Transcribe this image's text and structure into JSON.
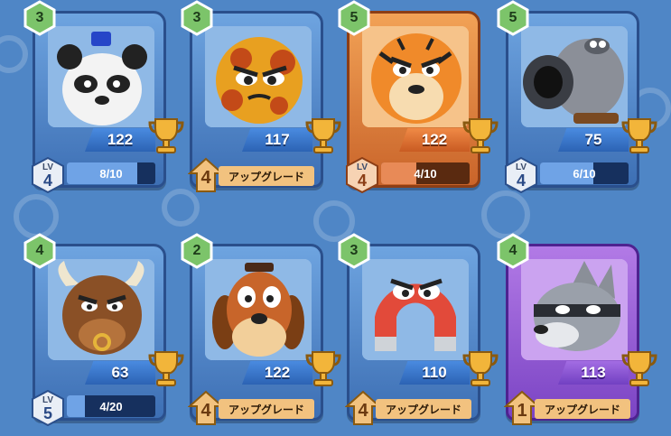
{
  "colors": {
    "background": "#4f86c6",
    "blue_frame": "#3d6fb4",
    "orange_frame": "#c9642a",
    "purple_frame": "#7b44c4",
    "gem_green": "#7cc46a",
    "gold": "#f2b53a"
  },
  "cards": [
    {
      "character": "panda",
      "star": "3",
      "trophies": "122",
      "frame": "blue",
      "lv_label": "LV",
      "level": "4",
      "progress": "8/10",
      "progress_fraction": 0.8
    },
    {
      "character": "fire-ball",
      "star": "3",
      "trophies": "117",
      "frame": "blue",
      "upgrade_count": "4",
      "upgrade_label": "アップグレード"
    },
    {
      "character": "tiger",
      "star": "5",
      "trophies": "122",
      "frame": "orange",
      "lv_label": "LV",
      "level": "4",
      "progress": "4/10",
      "progress_fraction": 0.4
    },
    {
      "character": "cannon-hippo",
      "star": "5",
      "trophies": "75",
      "frame": "blue",
      "lv_label": "LV",
      "level": "4",
      "progress": "6/10",
      "progress_fraction": 0.6
    },
    {
      "character": "bull",
      "star": "4",
      "trophies": "63",
      "frame": "blue",
      "lv_label": "LV",
      "level": "5",
      "progress": "4/20",
      "progress_fraction": 0.2
    },
    {
      "character": "dog",
      "star": "2",
      "trophies": "122",
      "frame": "blue",
      "upgrade_count": "4",
      "upgrade_label": "アップグレード"
    },
    {
      "character": "magnet",
      "star": "3",
      "trophies": "110",
      "frame": "blue",
      "upgrade_count": "4",
      "upgrade_label": "アップグレード"
    },
    {
      "character": "wolf",
      "star": "4",
      "trophies": "113",
      "frame": "purple",
      "upgrade_count": "1",
      "upgrade_label": "アップグレード"
    }
  ]
}
